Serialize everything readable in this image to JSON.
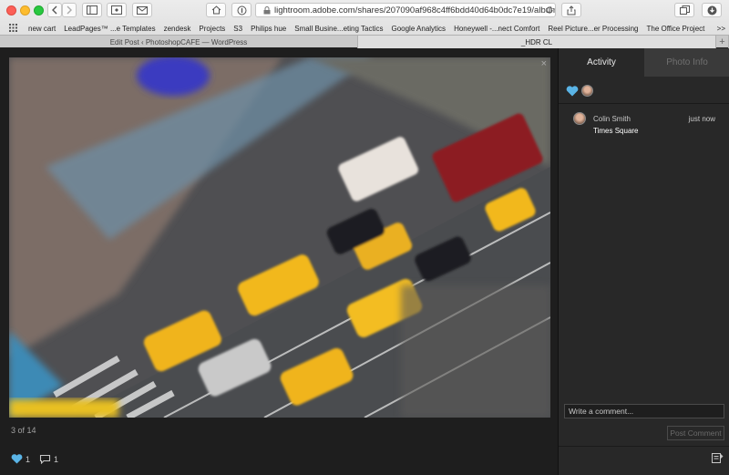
{
  "browser": {
    "url": "lightroom.adobe.com/shares/207090af968c4ff6bdd40d64b0dc7e19/albums/dd",
    "bookmarks": [
      "new cart",
      "LeadPages™ ...e Templates",
      "zendesk",
      "Projects",
      "S3",
      "Philips hue",
      "Small Busine...eting Tactics",
      "Google Analytics",
      "Honeywell -...nect Comfort",
      "Reel Picture...er Processing",
      "The Office Project"
    ],
    "bookmarks_more": ">>",
    "tabs": [
      {
        "label": "Edit Post ‹ PhotoshopCAFE — WordPress",
        "active": false
      },
      {
        "label": "_HDR CL",
        "active": true
      }
    ],
    "tab_add": "+"
  },
  "viewer": {
    "photo_close": "×",
    "counter": "3 of 14",
    "likes_count": "1",
    "comments_count": "1"
  },
  "sidebar": {
    "tabs": [
      {
        "label": "Activity",
        "active": true
      },
      {
        "label": "Photo Info",
        "active": false
      }
    ],
    "comment": {
      "author": "Colin Smith",
      "time": "just now",
      "text": "Times Square"
    },
    "comment_placeholder": "Write a comment...",
    "post_label": "Post Comment"
  },
  "colors": {
    "accent_heart": "#5ab4e6",
    "panel_bg": "#282828",
    "page_bg": "#1e1e1e"
  }
}
